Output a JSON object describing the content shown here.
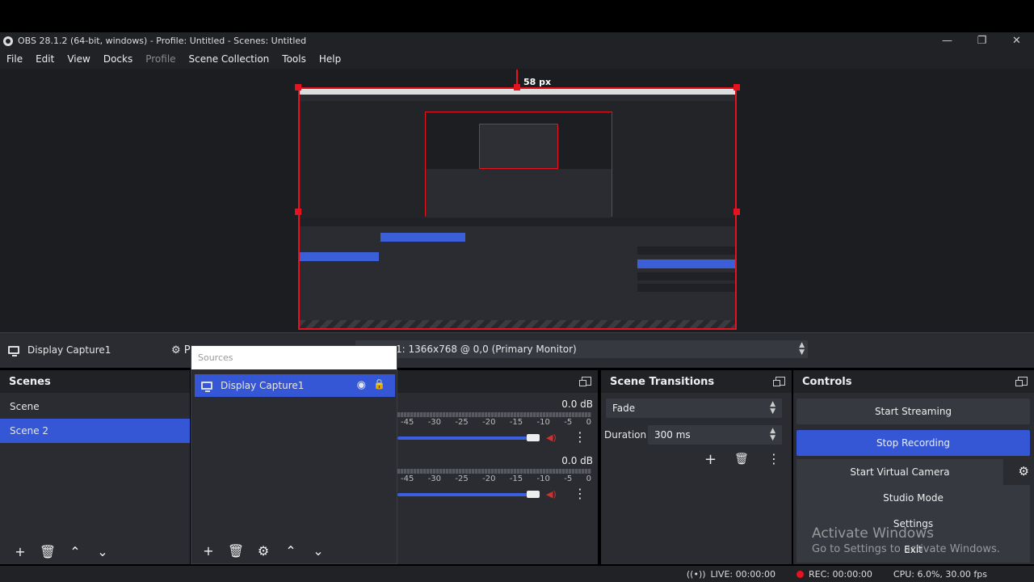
{
  "window": {
    "title": "OBS 28.1.2 (64-bit, windows) - Profile: Untitled - Scenes: Untitled",
    "minimize": "—",
    "restore": "❐",
    "close": "✕"
  },
  "menu": {
    "items": [
      "File",
      "Edit",
      "View",
      "Docks",
      "Profile",
      "Scene Collection",
      "Tools",
      "Help"
    ]
  },
  "preview": {
    "guide_label": "58 px"
  },
  "source_bar": {
    "selected_source": "Display Capture1",
    "properties_label": "P",
    "display_value": "1: 1366x768 @ 0,0 (Primary Monitor)"
  },
  "scenes": {
    "title": "Scenes",
    "items": [
      "Scene",
      "Scene 2"
    ],
    "active_index": 1
  },
  "sources": {
    "title": "Sources",
    "items": [
      "Display Capture1"
    ]
  },
  "mixer": {
    "channels": [
      {
        "level": "0.0 dB"
      },
      {
        "level": "0.0 dB"
      }
    ],
    "scale": [
      "-45",
      "-30",
      "-25",
      "-20",
      "-15",
      "-10",
      "-5",
      "0"
    ],
    "volume": 1.0
  },
  "transitions": {
    "title": "Scene Transitions",
    "selected": "Fade",
    "duration_label": "Duration",
    "duration_value": "300 ms"
  },
  "controls": {
    "title": "Controls",
    "start_streaming": "Start Streaming",
    "stop_recording": "Stop Recording",
    "start_virtual_camera": "Start Virtual Camera",
    "studio_mode": "Studio Mode",
    "settings": "Settings",
    "exit": "Exit"
  },
  "watermark": {
    "line1": "Activate Windows",
    "line2": "Go to Settings to activate Windows."
  },
  "status": {
    "live": "LIVE: 00:00:00",
    "rec": "REC: 00:00:00",
    "cpu": "CPU: 6.0%, 30.00 fps"
  },
  "colors": {
    "accent": "#3557d5",
    "selection_border": "#e4131f",
    "panel": "#2a2c31"
  }
}
